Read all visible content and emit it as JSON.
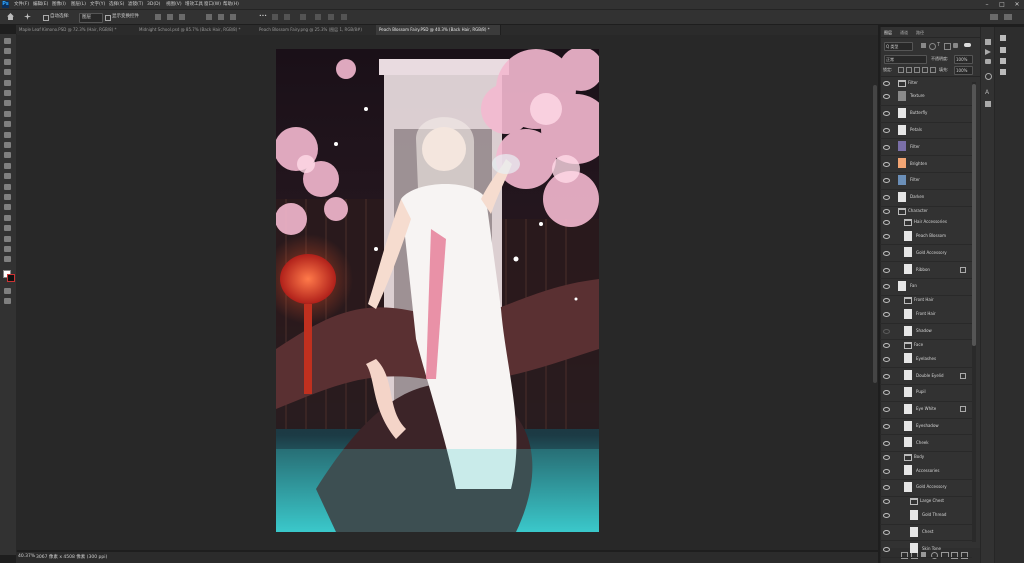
{
  "menu": [
    "文件(F)",
    "编辑(E)",
    "图像(I)",
    "图层(L)",
    "文字(Y)",
    "选择(S)",
    "滤镜(T)",
    "3D(D)",
    "视图(V)",
    "增效工具",
    "窗口(W)",
    "帮助(H)"
  ],
  "options": {
    "auto_select": "自动选择:",
    "layer_select": "图层",
    "show_transform": "显示变换控件",
    "more": "•••"
  },
  "tabs": [
    {
      "label": "Maple Leaf Kimono.PSD @ 72.3% (Hair, RGB/8) *",
      "active": false
    },
    {
      "label": "Midnight School.psd @ 85.7% (Back Hair, RGB/8) *",
      "active": false
    },
    {
      "label": "Peach Blossom Fairy.png @ 25.3% (图层 1, RGB/8#)",
      "active": false
    },
    {
      "label": "Peach Blossom Fairy.PSD @ 40.3% (Back Hair, RGB/8) *",
      "active": true
    }
  ],
  "status": {
    "zoom": "40.37%",
    "doc_info": "3067 像素 x 4508 像素 (300 ppi)"
  },
  "panel": {
    "tabs": [
      "图层",
      "通道",
      "路径"
    ],
    "kind_label": "Q 类型",
    "blend_mode": "正常",
    "opacity_label": "不透明度:",
    "opacity": "100%",
    "lock_label": "锁定:",
    "fill_label": "填充:",
    "fill": "100%"
  },
  "layers": [
    {
      "name": "Filter",
      "type": "group",
      "depth": 0,
      "thumb": ""
    },
    {
      "name": "Texture",
      "type": "layer",
      "depth": 0,
      "thumb": "#8a8a8a"
    },
    {
      "name": "Butterfly",
      "type": "layer",
      "depth": 0,
      "thumb": "#e6e6e6"
    },
    {
      "name": "Petals",
      "type": "layer",
      "depth": 0,
      "thumb": "#e6e6e6"
    },
    {
      "name": "Filter",
      "type": "layer",
      "depth": 0,
      "thumb": "#7a6fa8"
    },
    {
      "name": "Brighten",
      "type": "layer",
      "depth": 0,
      "thumb": "#f2a574"
    },
    {
      "name": "Filter",
      "type": "layer",
      "depth": 0,
      "thumb": "#6b8fb8"
    },
    {
      "name": "Darken",
      "type": "layer",
      "depth": 0,
      "thumb": "#e6e6e6"
    },
    {
      "name": "Character",
      "type": "group",
      "depth": 0,
      "thumb": ""
    },
    {
      "name": "Hair Accessories",
      "type": "group",
      "depth": 1,
      "thumb": ""
    },
    {
      "name": "Peach Blossom",
      "type": "layer",
      "depth": 1,
      "thumb": "#e6e6e6"
    },
    {
      "name": "Gold Accessory",
      "type": "layer",
      "depth": 1,
      "thumb": "#e6e6e6"
    },
    {
      "name": "Ribbon",
      "type": "layer",
      "depth": 1,
      "thumb": "#e6e6e6",
      "locked": true
    },
    {
      "name": "Fan",
      "type": "layer",
      "depth": 0,
      "thumb": "#e6e6e6"
    },
    {
      "name": "Front Hair",
      "type": "group",
      "depth": 1,
      "thumb": ""
    },
    {
      "name": "Front Hair",
      "type": "layer",
      "depth": 1,
      "thumb": "#e6e6e6"
    },
    {
      "name": "Shadow",
      "type": "layer",
      "depth": 1,
      "thumb": "#e6e6e6",
      "hidden": true
    },
    {
      "name": "Face",
      "type": "group",
      "depth": 1,
      "thumb": ""
    },
    {
      "name": "Eyelashes",
      "type": "layer",
      "depth": 1,
      "thumb": "#e6e6e6"
    },
    {
      "name": "Double Eyelid",
      "type": "layer",
      "depth": 1,
      "thumb": "#e6e6e6",
      "locked": true
    },
    {
      "name": "Pupil",
      "type": "layer",
      "depth": 1,
      "thumb": "#e6e6e6"
    },
    {
      "name": "Eye White",
      "type": "layer",
      "depth": 1,
      "thumb": "#e6e6e6",
      "locked": true
    },
    {
      "name": "Eyeshadow",
      "type": "layer",
      "depth": 1,
      "thumb": "#e6e6e6"
    },
    {
      "name": "Cheek",
      "type": "layer",
      "depth": 1,
      "thumb": "#e6e6e6"
    },
    {
      "name": "Body",
      "type": "group",
      "depth": 1,
      "thumb": ""
    },
    {
      "name": "Accessories",
      "type": "layer",
      "depth": 1,
      "thumb": "#e6e6e6"
    },
    {
      "name": "Gold Accessory",
      "type": "layer",
      "depth": 1,
      "thumb": "#e6e6e6"
    },
    {
      "name": "Large Chest",
      "type": "group",
      "depth": 2,
      "thumb": ""
    },
    {
      "name": "Gold Thread",
      "type": "layer",
      "depth": 2,
      "thumb": "#e6e6e6"
    },
    {
      "name": "Chest",
      "type": "layer",
      "depth": 2,
      "thumb": "#e6e6e6"
    },
    {
      "name": "Skin Tone",
      "type": "layer",
      "depth": 2,
      "thumb": "#e6e6e6"
    }
  ]
}
